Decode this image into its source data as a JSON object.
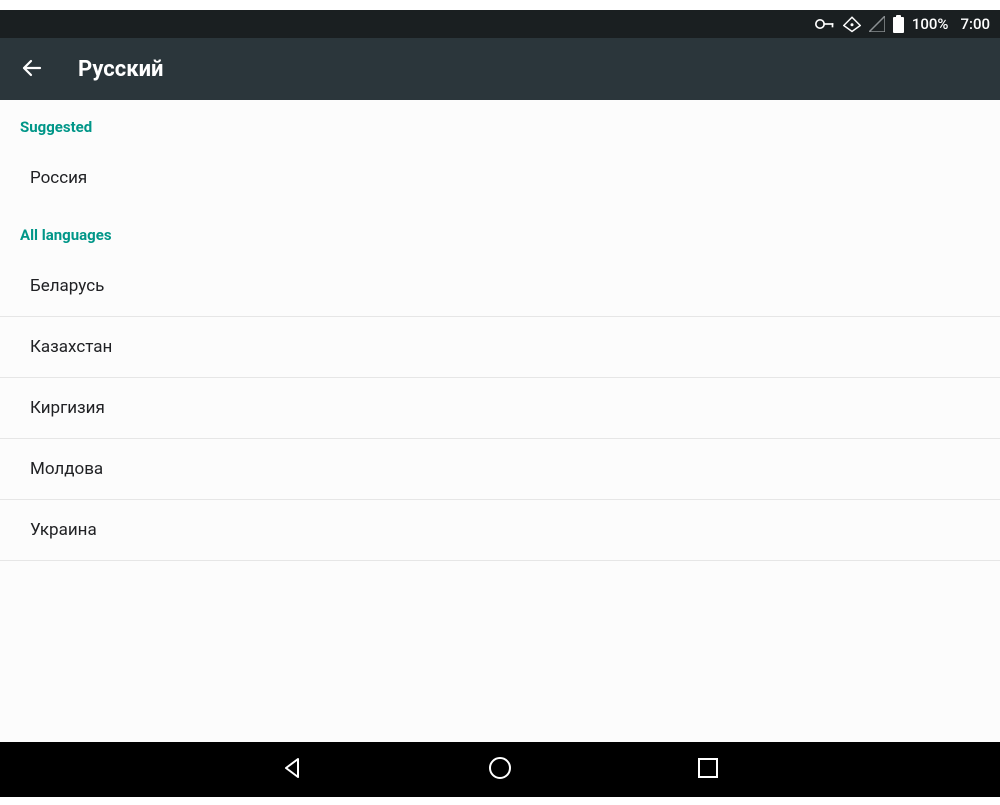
{
  "status_bar": {
    "battery_pct": "100%",
    "clock": "7:00"
  },
  "action_bar": {
    "title": "Русский"
  },
  "sections": {
    "suggested": {
      "header": "Suggested",
      "items": [
        {
          "label": "Россия"
        }
      ]
    },
    "all": {
      "header": "All languages",
      "items": [
        {
          "label": "Беларусь"
        },
        {
          "label": "Казахстан"
        },
        {
          "label": "Киргизия"
        },
        {
          "label": "Молдова"
        },
        {
          "label": "Украина"
        }
      ]
    }
  }
}
